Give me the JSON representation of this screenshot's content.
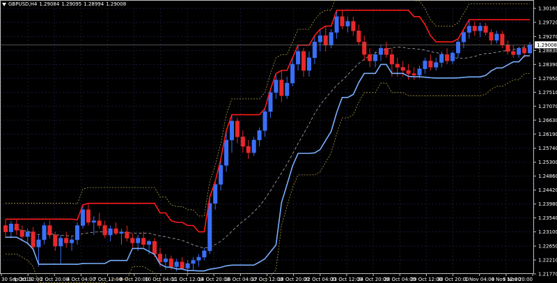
{
  "header": {
    "symbol": "GBPUSD,H4",
    "open": "1.29084",
    "high": "1.29095",
    "low": "1.28994",
    "close": "1.29008"
  },
  "price_axis": {
    "ticks": [
      "1.30160",
      "1.29720",
      "1.29270",
      "1.28830",
      "1.28390",
      "1.27950",
      "1.27510",
      "1.27070",
      "1.26630",
      "1.26190",
      "1.25740",
      "1.25300",
      "1.24860",
      "1.24420",
      "1.23980",
      "1.23540",
      "1.23100",
      "1.22650",
      "1.22210",
      "1.21770"
    ],
    "current_price": "1.29008"
  },
  "time_axis": {
    "labels": [
      "30 Sep 2019",
      "1 Oct 12:00",
      "2 Oct 20:00",
      "4 Oct 04:00",
      "7 Oct 12:00",
      "8 Oct 20:00",
      "10 Oct 04:00",
      "11 Oct 12:00",
      "14 Oct 20:00",
      "16 Oct 04:00",
      "17 Oct 12:00",
      "18 Oct 20:00",
      "22 Oct 04:00",
      "23 Oct 12:00",
      "24 Oct 20:00",
      "28 Oct 04:00",
      "29 Oct 12:00",
      "30 Oct 20:00",
      "1 Nov 04:00",
      "4 Nov 12:00",
      "5 Nov 20:00"
    ]
  },
  "colors": {
    "background": "#000000",
    "grid": "#1a1a3a",
    "bull": "#3a6ff7",
    "bear": "#e8282a",
    "red_line": "#ff1a1a",
    "blue_line": "#7ab0ff",
    "band": "#b0a040",
    "mid": "#b0b0b0",
    "axis_text": "#ffffff"
  },
  "chart_data": {
    "type": "candlestick",
    "symbol": "GBPUSD",
    "timeframe": "H4",
    "ylim": [
      1.2177,
      1.3016
    ],
    "candles": [
      [
        1.233,
        1.235,
        1.229,
        1.231
      ],
      [
        1.231,
        1.2345,
        1.229,
        1.2335
      ],
      [
        1.2335,
        1.2348,
        1.23,
        1.2315
      ],
      [
        1.2315,
        1.233,
        1.228,
        1.2295
      ],
      [
        1.2295,
        1.232,
        1.227,
        1.231
      ],
      [
        1.231,
        1.2325,
        1.225,
        1.2262
      ],
      [
        1.2262,
        1.23,
        1.22,
        1.2285
      ],
      [
        1.2285,
        1.234,
        1.227,
        1.233
      ],
      [
        1.233,
        1.2345,
        1.229,
        1.23
      ],
      [
        1.23,
        1.231,
        1.225,
        1.2265
      ],
      [
        1.2265,
        1.23,
        1.221,
        1.229
      ],
      [
        1.229,
        1.231,
        1.226,
        1.2275
      ],
      [
        1.2275,
        1.2295,
        1.225,
        1.2285
      ],
      [
        1.2285,
        1.234,
        1.227,
        1.233
      ],
      [
        1.233,
        1.2395,
        1.232,
        1.238
      ],
      [
        1.238,
        1.24,
        1.233,
        1.234
      ],
      [
        1.234,
        1.236,
        1.23,
        1.2345
      ],
      [
        1.2345,
        1.237,
        1.232,
        1.233
      ],
      [
        1.233,
        1.2345,
        1.229,
        1.23
      ],
      [
        1.23,
        1.233,
        1.228,
        1.232
      ],
      [
        1.232,
        1.234,
        1.23,
        1.2305
      ],
      [
        1.2305,
        1.232,
        1.227,
        1.231
      ],
      [
        1.231,
        1.233,
        1.228,
        1.229
      ],
      [
        1.229,
        1.2305,
        1.226,
        1.2275
      ],
      [
        1.2275,
        1.23,
        1.225,
        1.229
      ],
      [
        1.229,
        1.231,
        1.226,
        1.227
      ],
      [
        1.227,
        1.2285,
        1.224,
        1.228
      ],
      [
        1.228,
        1.229,
        1.223,
        1.224
      ],
      [
        1.224,
        1.226,
        1.22,
        1.2215
      ],
      [
        1.2215,
        1.224,
        1.219,
        1.2225
      ],
      [
        1.2225,
        1.2235,
        1.219,
        1.22
      ],
      [
        1.22,
        1.2225,
        1.2185,
        1.2215
      ],
      [
        1.2215,
        1.223,
        1.219,
        1.2195
      ],
      [
        1.2195,
        1.222,
        1.218,
        1.221
      ],
      [
        1.221,
        1.223,
        1.219,
        1.222
      ],
      [
        1.222,
        1.224,
        1.22,
        1.223
      ],
      [
        1.223,
        1.226,
        1.222,
        1.225
      ],
      [
        1.225,
        1.242,
        1.224,
        1.24
      ],
      [
        1.24,
        1.247,
        1.238,
        1.246
      ],
      [
        1.246,
        1.254,
        1.244,
        1.252
      ],
      [
        1.252,
        1.263,
        1.25,
        1.26
      ],
      [
        1.26,
        1.268,
        1.256,
        1.266
      ],
      [
        1.266,
        1.267,
        1.259,
        1.261
      ],
      [
        1.261,
        1.263,
        1.256,
        1.258
      ],
      [
        1.258,
        1.26,
        1.254,
        1.256
      ],
      [
        1.256,
        1.261,
        1.255,
        1.26
      ],
      [
        1.26,
        1.264,
        1.258,
        1.263
      ],
      [
        1.263,
        1.27,
        1.261,
        1.269
      ],
      [
        1.269,
        1.276,
        1.267,
        1.275
      ],
      [
        1.275,
        1.281,
        1.273,
        1.279
      ],
      [
        1.279,
        1.282,
        1.272,
        1.274
      ],
      [
        1.274,
        1.28,
        1.273,
        1.278
      ],
      [
        1.278,
        1.286,
        1.277,
        1.284
      ],
      [
        1.284,
        1.29,
        1.282,
        1.288
      ],
      [
        1.288,
        1.289,
        1.28,
        1.282
      ],
      [
        1.282,
        1.288,
        1.28,
        1.286
      ],
      [
        1.286,
        1.293,
        1.284,
        1.291
      ],
      [
        1.291,
        1.295,
        1.288,
        1.293
      ],
      [
        1.293,
        1.296,
        1.288,
        1.29
      ],
      [
        1.29,
        1.295,
        1.289,
        1.294
      ],
      [
        1.294,
        1.301,
        1.292,
        1.299
      ],
      [
        1.299,
        1.301,
        1.295,
        1.296
      ],
      [
        1.296,
        1.299,
        1.294,
        1.2975
      ],
      [
        1.2975,
        1.299,
        1.293,
        1.2945
      ],
      [
        1.2945,
        1.2965,
        1.29,
        1.291
      ],
      [
        1.291,
        1.293,
        1.285,
        1.287
      ],
      [
        1.287,
        1.289,
        1.283,
        1.285
      ],
      [
        1.285,
        1.288,
        1.283,
        1.287
      ],
      [
        1.287,
        1.29,
        1.285,
        1.289
      ],
      [
        1.289,
        1.291,
        1.286,
        1.287
      ],
      [
        1.287,
        1.289,
        1.28,
        1.284
      ],
      [
        1.284,
        1.286,
        1.28,
        1.283
      ],
      [
        1.283,
        1.285,
        1.28,
        1.282
      ],
      [
        1.282,
        1.284,
        1.279,
        1.281
      ],
      [
        1.281,
        1.283,
        1.279,
        1.2805
      ],
      [
        1.2805,
        1.2835,
        1.2795,
        1.2825
      ],
      [
        1.2825,
        1.286,
        1.281,
        1.285
      ],
      [
        1.285,
        1.287,
        1.282,
        1.283
      ],
      [
        1.283,
        1.286,
        1.282,
        1.2845
      ],
      [
        1.2845,
        1.288,
        1.283,
        1.287
      ],
      [
        1.287,
        1.289,
        1.284,
        1.285
      ],
      [
        1.285,
        1.288,
        1.284,
        1.2875
      ],
      [
        1.2875,
        1.292,
        1.286,
        1.291
      ],
      [
        1.291,
        1.295,
        1.289,
        1.294
      ],
      [
        1.294,
        1.298,
        1.292,
        1.296
      ],
      [
        1.296,
        1.2975,
        1.293,
        1.2945
      ],
      [
        1.2945,
        1.297,
        1.2925,
        1.296
      ],
      [
        1.296,
        1.297,
        1.293,
        1.294
      ],
      [
        1.294,
        1.295,
        1.29,
        1.2915
      ],
      [
        1.2915,
        1.2945,
        1.2905,
        1.2935
      ],
      [
        1.2935,
        1.2945,
        1.289,
        1.29
      ],
      [
        1.29,
        1.2915,
        1.287,
        1.288
      ],
      [
        1.288,
        1.29,
        1.286,
        1.287
      ],
      [
        1.287,
        1.2895,
        1.286,
        1.289
      ],
      [
        1.289,
        1.29,
        1.286,
        1.2875
      ],
      [
        1.2875,
        1.291,
        1.287,
        1.2901
      ]
    ]
  }
}
